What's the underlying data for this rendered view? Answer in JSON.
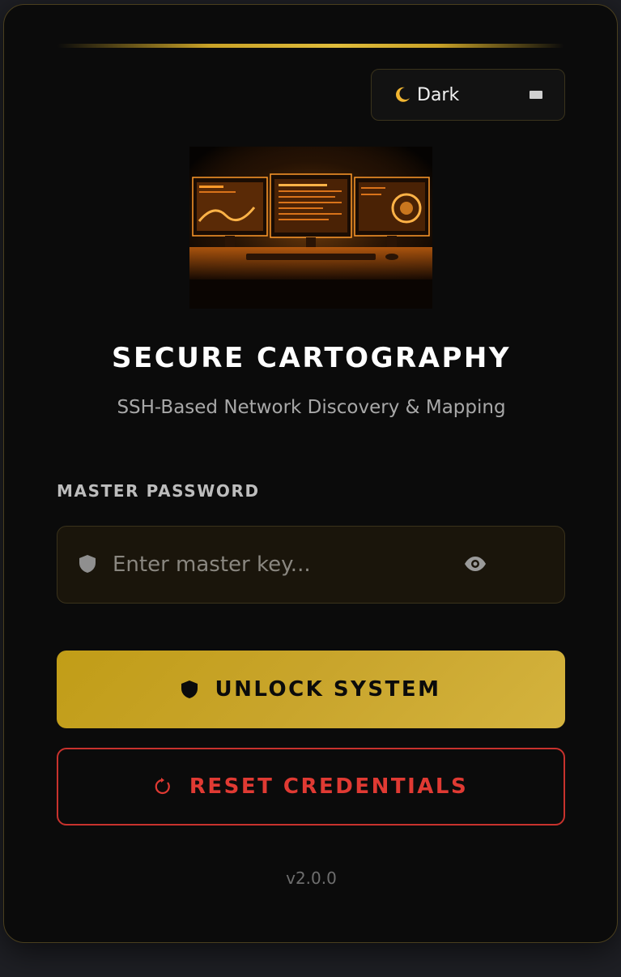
{
  "theme_toggle": {
    "icon": "moon-icon",
    "label": "Dark"
  },
  "app": {
    "title": "SECURE CARTOGRAPHY",
    "subtitle": "SSH-Based Network Discovery & Mapping"
  },
  "password": {
    "label": "MASTER PASSWORD",
    "placeholder": "Enter master key...",
    "value": ""
  },
  "buttons": {
    "unlock_label": "UNLOCK SYSTEM",
    "reset_label": "RESET CREDENTIALS"
  },
  "footer": {
    "version": "v2.0.0"
  },
  "colors": {
    "accent": "#c9a227",
    "danger": "#e03a33",
    "background": "#0b0b0b"
  }
}
